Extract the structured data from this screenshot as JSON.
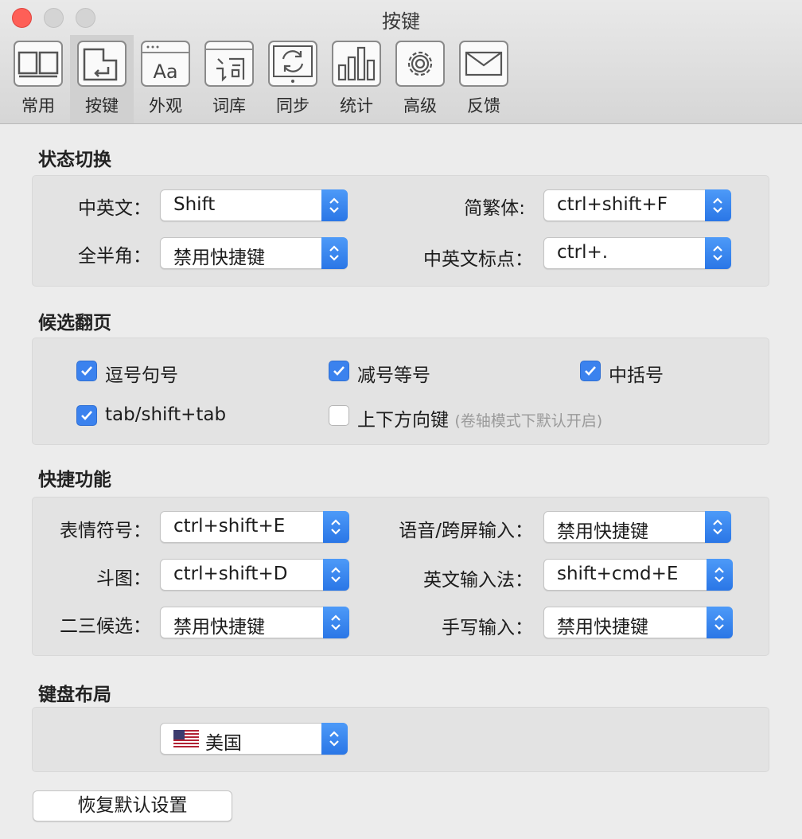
{
  "window": {
    "title": "按键"
  },
  "toolbar": {
    "tabs": [
      {
        "label": "常用",
        "icon": "layout-icon"
      },
      {
        "label": "按键",
        "icon": "keyboard-enter-icon"
      },
      {
        "label": "外观",
        "icon": "font-appearance-icon"
      },
      {
        "label": "词库",
        "icon": "dictionary-icon"
      },
      {
        "label": "同步",
        "icon": "sync-icon"
      },
      {
        "label": "统计",
        "icon": "bar-chart-icon"
      },
      {
        "label": "高级",
        "icon": "gear-icon"
      },
      {
        "label": "反馈",
        "icon": "mail-icon"
      }
    ],
    "active": "按键"
  },
  "state_switch": {
    "title": "状态切换",
    "cn_en": {
      "label": "中英文：",
      "value": "Shift"
    },
    "simp_trad": {
      "label": "简繁体:",
      "value": "ctrl+shift+F"
    },
    "full_half": {
      "label": "全半角：",
      "value": "禁用快捷键"
    },
    "cn_en_punct": {
      "label": "中英文标点：",
      "value": "ctrl+."
    }
  },
  "paging": {
    "title": "候选翻页",
    "comma_period": {
      "label": "逗号句号",
      "checked": true
    },
    "minus_equal": {
      "label": "减号等号",
      "checked": true
    },
    "brackets": {
      "label": "中括号",
      "checked": true
    },
    "tab_shift_tab": {
      "label": "tab/shift+tab",
      "checked": true
    },
    "arrow_keys": {
      "label": "上下方向键",
      "hint": "(卷轴模式下默认开启)",
      "checked": false
    }
  },
  "shortcuts": {
    "title": "快捷功能",
    "emoji": {
      "label": "表情符号：",
      "value": "ctrl+shift+E"
    },
    "voice": {
      "label": "语音/跨屏输入：",
      "value": "禁用快捷键"
    },
    "doutu": {
      "label": "斗图：",
      "value": "ctrl+shift+D"
    },
    "english_ime": {
      "label": "英文输入法：",
      "value": "shift+cmd+E"
    },
    "second_third": {
      "label": "二三候选：",
      "value": "禁用快捷键"
    },
    "handwriting": {
      "label": "手写输入：",
      "value": "禁用快捷键"
    }
  },
  "keyboard_layout": {
    "title": "键盘布局",
    "value": "美国",
    "flag_icon": "us-flag-icon"
  },
  "reset_button": "恢复默认设置",
  "colors": {
    "accent": "#3b82ee",
    "close": "#fe5f57"
  }
}
